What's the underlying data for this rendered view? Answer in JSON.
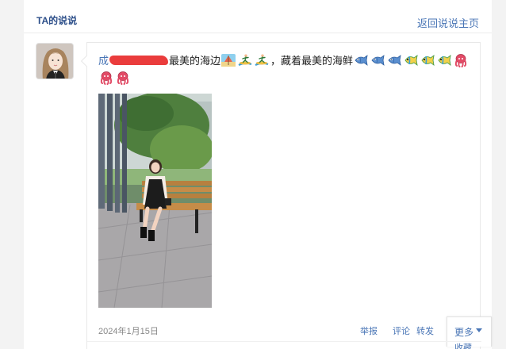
{
  "header": {
    "title": "TA的说说",
    "back_link": "返回说说主页"
  },
  "post": {
    "author_visible": "成",
    "text_part1": "最美的海边",
    "text_part2": "，藏着最美的海鲜",
    "emoji_group1": [
      "beach-umbrella-icon",
      "surfer-icon",
      "surfer-icon"
    ],
    "emoji_group2": [
      "fish-icon",
      "fish-icon",
      "fish-icon",
      "tropical-fish-icon",
      "tropical-fish-icon",
      "tropical-fish-icon",
      "octopus-icon",
      "octopus-icon",
      "octopus-icon"
    ],
    "photo_subject": "girl-on-bench-photo",
    "date": "2024年1月15日",
    "actions": {
      "report": "举报",
      "comment": "评论",
      "forward": "转发",
      "more": "更多",
      "more_sub": "收藏"
    }
  },
  "colors": {
    "link": "#4a76b6",
    "title": "#2d4f8a",
    "redaction": "#ea3c3c",
    "background": "#f3f3f3"
  }
}
